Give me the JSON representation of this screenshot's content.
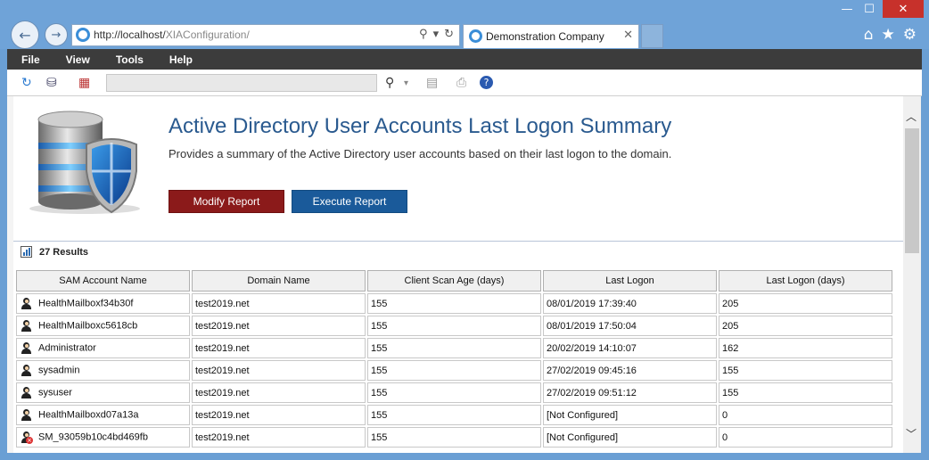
{
  "browser": {
    "url_prefix": "http://localhost/",
    "url_path": "XIAConfiguration/",
    "tab_title": "Demonstration Company",
    "tab_close": "✕",
    "nav_back": "←",
    "nav_forward": "→",
    "window_min": "—",
    "window_max": "☐",
    "window_close": "✕"
  },
  "menu": {
    "items": [
      "File",
      "View",
      "Tools",
      "Help"
    ]
  },
  "report": {
    "title": "Active Directory User Accounts Last Logon Summary",
    "description": "Provides a summary of the Active Directory user accounts based on their last logon to the domain.",
    "modify_label": "Modify Report",
    "execute_label": "Execute Report",
    "results_label": "27 Results"
  },
  "table": {
    "headers": [
      "SAM Account Name",
      "Domain Name",
      "Client Scan Age (days)",
      "Last Logon",
      "Last Logon (days)"
    ],
    "rows": [
      {
        "name": "HealthMailboxf34b30f",
        "domain": "test2019.net",
        "scan_age": "155",
        "last_logon": "08/01/2019 17:39:40",
        "days": "205",
        "disabled": false
      },
      {
        "name": "HealthMailboxc5618cb",
        "domain": "test2019.net",
        "scan_age": "155",
        "last_logon": "08/01/2019 17:50:04",
        "days": "205",
        "disabled": false
      },
      {
        "name": "Administrator",
        "domain": "test2019.net",
        "scan_age": "155",
        "last_logon": "20/02/2019 14:10:07",
        "days": "162",
        "disabled": false
      },
      {
        "name": "sysadmin",
        "domain": "test2019.net",
        "scan_age": "155",
        "last_logon": "27/02/2019 09:45:16",
        "days": "155",
        "disabled": false
      },
      {
        "name": "sysuser",
        "domain": "test2019.net",
        "scan_age": "155",
        "last_logon": "27/02/2019 09:51:12",
        "days": "155",
        "disabled": false
      },
      {
        "name": "HealthMailboxd07a13a",
        "domain": "test2019.net",
        "scan_age": "155",
        "last_logon": "[Not Configured]",
        "days": "0",
        "disabled": false
      },
      {
        "name": "SM_93059b10c4bd469fb",
        "domain": "test2019.net",
        "scan_age": "155",
        "last_logon": "[Not Configured]",
        "days": "0",
        "disabled": true
      }
    ]
  }
}
